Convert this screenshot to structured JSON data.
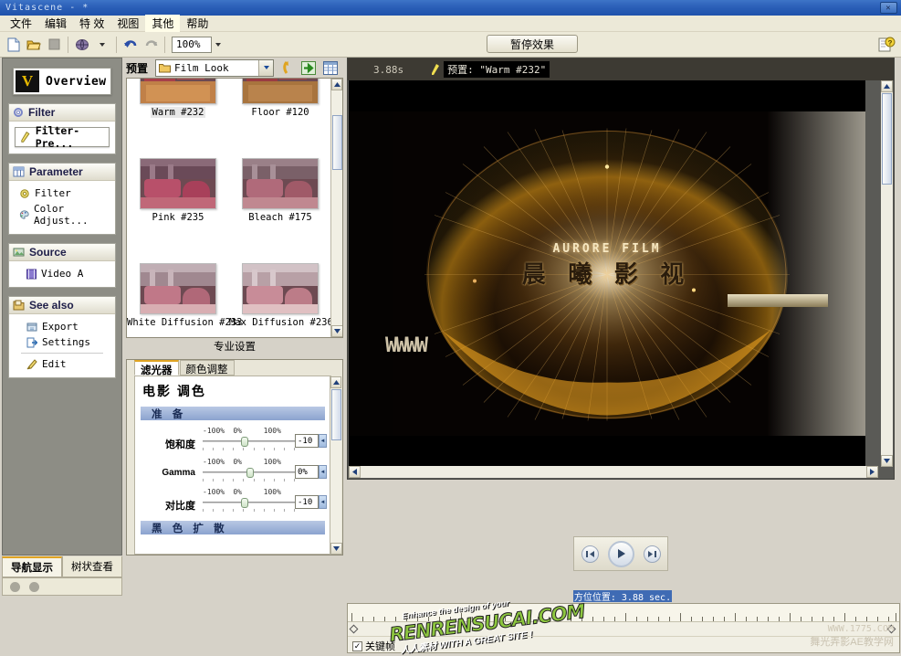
{
  "window": {
    "title": "Vitascene - *",
    "close_label": "✕"
  },
  "menu": {
    "items": [
      "文件",
      "编辑",
      "特 效",
      "视图",
      "其他",
      "帮助"
    ],
    "highlighted_index": 4
  },
  "toolbar": {
    "icons": [
      "new-document",
      "open-folder",
      "stop",
      "globe",
      "globe-dropdown",
      "undo",
      "redo"
    ],
    "zoom_value": "100%",
    "pause_button": "暂停效果",
    "help_icon": "help"
  },
  "sidebar": {
    "overview_button": "Overview",
    "overview_logo": "V",
    "groups": [
      {
        "title": "Filter",
        "icon": "gear-icon",
        "items": [
          {
            "label": "Filter-Pre...",
            "icon": "pencil-icon",
            "style": "big"
          }
        ]
      },
      {
        "title": "Parameter",
        "icon": "table-icon",
        "items": [
          {
            "label": "Filter",
            "icon": "gear-icon",
            "style": "small"
          },
          {
            "label": "Color Adjust...",
            "icon": "palette-icon",
            "style": "small"
          }
        ]
      },
      {
        "title": "Source",
        "icon": "image-icon",
        "items": [
          {
            "label": "Video A",
            "icon": "film-icon",
            "style": "small"
          }
        ]
      },
      {
        "title": "See also",
        "icon": "folder-icon",
        "items": [
          {
            "label": "Export",
            "icon": "export-icon",
            "style": "small"
          },
          {
            "label": "Settings",
            "icon": "settings-icon",
            "style": "small"
          },
          {
            "label": "Edit",
            "icon": "brush-icon",
            "style": "small"
          }
        ]
      }
    ],
    "tabs": [
      {
        "label": "导航显示",
        "active": true
      },
      {
        "label": "树状查看",
        "active": false
      }
    ]
  },
  "preset": {
    "label": "预置",
    "selected_folder": "Film Look",
    "buttons": [
      "up-arrow-icon",
      "import-icon",
      "grid-view-icon"
    ],
    "pro_settings_label": "专业设置",
    "items": [
      {
        "name": "Warm #232",
        "selected": true,
        "c1": "#3a1c18",
        "c2": "#9c4a3c",
        "c3": "#d8a070"
      },
      {
        "name": "Floor #120",
        "selected": false,
        "c1": "#2e1a1c",
        "c2": "#8e4038",
        "c3": "#b88a66"
      },
      {
        "name": "Pink #235",
        "selected": false,
        "c1": "#4a2a36",
        "c2": "#b05a70",
        "c3": "#d8a8b8"
      },
      {
        "name": "Bleach #175",
        "selected": false,
        "c1": "#5a3a42",
        "c2": "#a86a76",
        "c3": "#cfb0a8"
      },
      {
        "name": "White Diffusion #233",
        "selected": false,
        "c1": "#6a4a52",
        "c2": "#c08890",
        "c3": "#e0c8c4"
      },
      {
        "name": "Max Diffusion #236",
        "selected": false,
        "c1": "#7a5a60",
        "c2": "#c89098",
        "c3": "#e8d4cc"
      }
    ]
  },
  "parameters": {
    "tabs": [
      {
        "label": "滤光器",
        "active": true
      },
      {
        "label": "颜色调整",
        "active": false
      }
    ],
    "heading": "电影 调色",
    "section_prepare": "准 备",
    "section_black": "黑 色 扩 散",
    "sliders": [
      {
        "label": "饱和度",
        "min_label": "-100%",
        "mid_label": "0%",
        "max_label": "100%",
        "value": "-10",
        "knob_pct": 42
      },
      {
        "label": "Gamma",
        "min_label": "-100%",
        "mid_label": "0%",
        "max_label": "100%",
        "value": "0%",
        "knob_pct": 48
      },
      {
        "label": "对比度",
        "min_label": "-100%",
        "mid_label": "0%",
        "max_label": "100%",
        "value": "-10",
        "knob_pct": 42
      }
    ]
  },
  "preview": {
    "timestamp": "3.88s",
    "preset_icon": "pencil-icon",
    "preset_text": "预置:   \"Warm #232\"",
    "video": {
      "title_en": "AURORE  FILM",
      "title_cn": "晨 曦 影 视",
      "www_text": "WWWW"
    }
  },
  "transport": {
    "buttons": [
      "step-back-icon",
      "play-icon",
      "step-forward-icon"
    ]
  },
  "timeline": {
    "position_label": "方位位置:  3.88 sec.",
    "keyframe_checkbox": "关键帧",
    "keyframe_checked": "✓"
  },
  "watermarks": {
    "main_line1": "Enhance the design of your",
    "main_line2": "RENRENSUCAI.COM",
    "main_line3": "人人素材  WITH A GREAT SITE !",
    "corner_line1": "WWW.1775.COM",
    "corner_line2": "舞光弄影AE教学网"
  }
}
